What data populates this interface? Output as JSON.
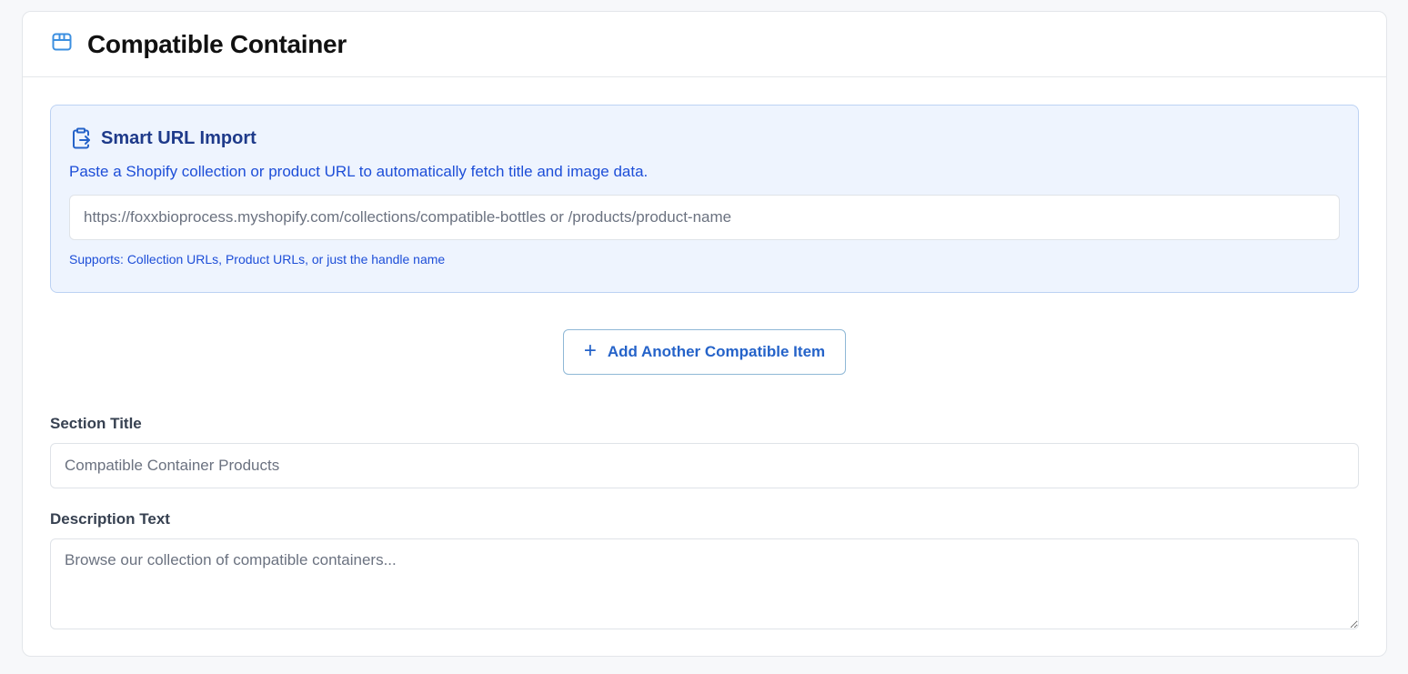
{
  "card": {
    "title": "Compatible Container",
    "icon": "package-icon"
  },
  "smart_import": {
    "icon": "clipboard-import-icon",
    "title": "Smart URL Import",
    "description": "Paste a Shopify collection or product URL to automatically fetch title and image data.",
    "url_placeholder": "https://foxxbioprocess.myshopify.com/collections/compatible-bottles or /products/product-name",
    "url_value": "",
    "hint": "Supports: Collection URLs, Product URLs, or just the handle name"
  },
  "add_button": {
    "icon": "plus-icon",
    "label": "Add Another Compatible Item"
  },
  "section_title": {
    "label": "Section Title",
    "placeholder": "Compatible Container Products",
    "value": ""
  },
  "description_text": {
    "label": "Description Text",
    "placeholder": "Browse our collection of compatible containers...",
    "value": ""
  },
  "colors": {
    "accent": "#2563c9",
    "import_bg": "#eef4fe",
    "import_border": "#bcd2f3",
    "import_title": "#1e3a8a",
    "icon_blue": "#3b8fe0"
  }
}
